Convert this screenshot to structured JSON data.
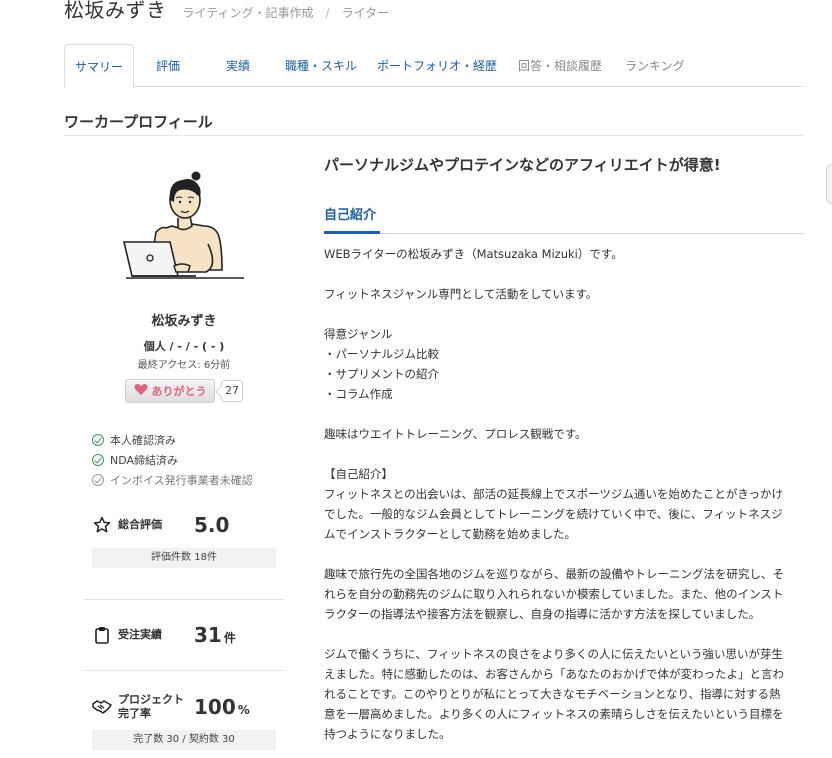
{
  "header": {
    "name": "松坂みずき",
    "category": "ライティング・記事作成",
    "separator": "/",
    "role": "ライター"
  },
  "tabs": [
    {
      "label": "サマリー",
      "active": true
    },
    {
      "label": "評価"
    },
    {
      "label": "実績"
    },
    {
      "label": "職種・スキル"
    },
    {
      "label": "ポートフォリオ・経歴"
    },
    {
      "label": "回答・相談履歴",
      "disabled": true
    },
    {
      "label": "ランキング",
      "disabled": true
    }
  ],
  "section_title": "ワーカープロフィール",
  "profile": {
    "name": "松坂みずき",
    "type": "個人 / - / - ( - )",
    "last_access": "最終アクセス: 6分前",
    "thanks_label": "ありがとう",
    "thanks_count": "27",
    "checks": [
      {
        "label": "本人確認済み",
        "verified": true
      },
      {
        "label": "NDA締結済み",
        "verified": true
      },
      {
        "label": "インボイス発行事業者未確認",
        "verified": false
      }
    ]
  },
  "stats": {
    "rating": {
      "label": "総合評価",
      "value": "5.0",
      "sub": "評価件数 18件"
    },
    "orders": {
      "label": "受注実績",
      "value": "31",
      "unit": "件"
    },
    "completion": {
      "label": "プロジェクト完了率",
      "value": "100",
      "unit": "%",
      "sub": "完了数 30 / 契約数 30"
    }
  },
  "main": {
    "catch": "パーソナルジムやプロテインなどのアフィリエイトが得意!",
    "intro_title": "自己紹介",
    "intro_lines": [
      "WEBライターの松坂みずき（Matsuzaka Mizuki）です。",
      "",
      "フィットネスジャンル専門として活動をしています。",
      "",
      "得意ジャンル",
      "・パーソナルジム比較",
      "・サプリメントの紹介",
      "・コラム作成",
      "",
      "趣味はウエイトトレーニング、プロレス観戦です。",
      "",
      "【自己紹介】",
      "フィットネスとの出会いは、部活の延長線上でスポーツジム通いを始めたことがきっかけ",
      "でした。一般的なジム会員としてトレーニングを続けていく中で、後に、フィットネスジ",
      "ムでインストラクターとして勤務を始めました。",
      "",
      "趣味で旅行先の全国各地のジムを巡りながら、最新の設備やトレーニング法を研究し、そ",
      "れらを自分の勤務先のジムに取り入れられないか模索していました。また、他のインスト",
      "ラクターの指導法や接客方法を観察し、自身の指導に活かす方法を探していました。",
      "",
      "ジムで働くうちに、フィットネスの良さをより多くの人に伝えたいという強い思いが芽生",
      "えました。特に感動したのは、お客さんから「あなたのおかげで体が変わったよ」と言わ",
      "れることです。このやりとりが私にとって大きなモチベーションとなり、指導に対する熱",
      "意を一層高めました。より多くの人にフィットネスの素晴らしさを伝えたいという目標を",
      "持つようになりました。"
    ]
  }
}
